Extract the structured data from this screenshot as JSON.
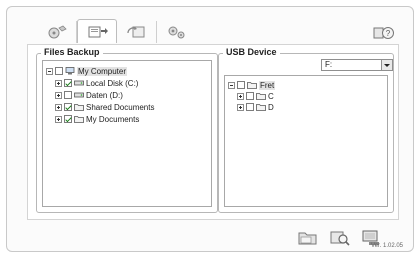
{
  "tabs": [
    {
      "icon": "drive-backup-icon",
      "active": false
    },
    {
      "icon": "files-backup-icon",
      "active": true
    },
    {
      "icon": "restore-icon",
      "active": false
    },
    {
      "icon": "settings-gears-icon",
      "active": false
    }
  ],
  "files_backup": {
    "title": "Files Backup",
    "tree": [
      {
        "label": "My Computer",
        "expander": "minus",
        "checked": false,
        "icon": "computer-icon",
        "selected": true
      },
      {
        "label": "Local Disk (C:)",
        "expander": "plus",
        "checked": true,
        "icon": "disk-icon"
      },
      {
        "label": "Daten (D:)",
        "expander": "plus",
        "checked": false,
        "icon": "disk-icon"
      },
      {
        "label": "Shared Documents",
        "expander": "plus",
        "checked": true,
        "icon": "folder-icon"
      },
      {
        "label": "My Documents",
        "expander": "plus",
        "checked": true,
        "icon": "folder-icon"
      }
    ]
  },
  "usb_device": {
    "title": "USB Device",
    "drive_select": "F:",
    "tree": [
      {
        "label": "Fret",
        "expander": "minus",
        "checked": false,
        "icon": "folder-icon",
        "selected": true
      },
      {
        "label": "C",
        "expander": "plus",
        "checked": false,
        "icon": "folder-icon"
      },
      {
        "label": "D",
        "expander": "plus",
        "checked": false,
        "icon": "folder-icon"
      }
    ]
  },
  "actions": [
    {
      "icon": "add-folder-icon"
    },
    {
      "icon": "search-backup-icon"
    },
    {
      "icon": "monitor-icon"
    }
  ],
  "version": "Ver. 1.02.05"
}
